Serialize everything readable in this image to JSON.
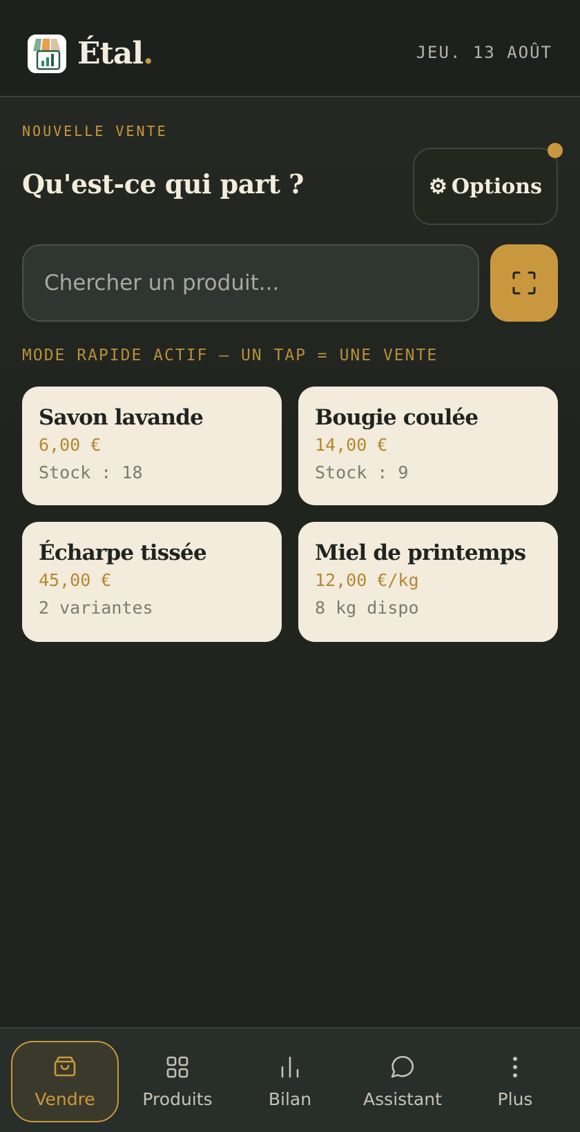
{
  "header": {
    "brand": "Étal",
    "brand_dot": ".",
    "date": "JEU. 13 AOÛT"
  },
  "sale": {
    "eyebrow": "NOUVELLE VENTE",
    "headline": "Qu'est-ce qui part ?",
    "options_label": "Options",
    "options_icon": "⚙",
    "search_placeholder": "Chercher un produit...",
    "mode_label": "MODE RAPIDE ACTIF — UN TAP = UNE VENTE"
  },
  "products": [
    {
      "name": "Savon lavande",
      "price": "6,00 €",
      "detail": "Stock : 18"
    },
    {
      "name": "Bougie coulée",
      "price": "14,00 €",
      "detail": "Stock : 9"
    },
    {
      "name": "Écharpe tissée",
      "price": "45,00 €",
      "detail": "2 variantes"
    },
    {
      "name": "Miel de printemps",
      "price": "12,00 €/kg",
      "detail": "8 kg dispo"
    }
  ],
  "nav": {
    "items": [
      {
        "label": "Vendre",
        "icon": "basket-icon",
        "active": true
      },
      {
        "label": "Produits",
        "icon": "grid-icon",
        "active": false
      },
      {
        "label": "Bilan",
        "icon": "bar-chart-icon",
        "active": false
      },
      {
        "label": "Assistant",
        "icon": "chat-bubble-icon",
        "active": false
      },
      {
        "label": "Plus",
        "icon": "more-vertical-icon",
        "active": false
      }
    ]
  },
  "colors": {
    "accent": "#c9983e",
    "background": "#1f2420",
    "card": "#f3ebdb"
  }
}
